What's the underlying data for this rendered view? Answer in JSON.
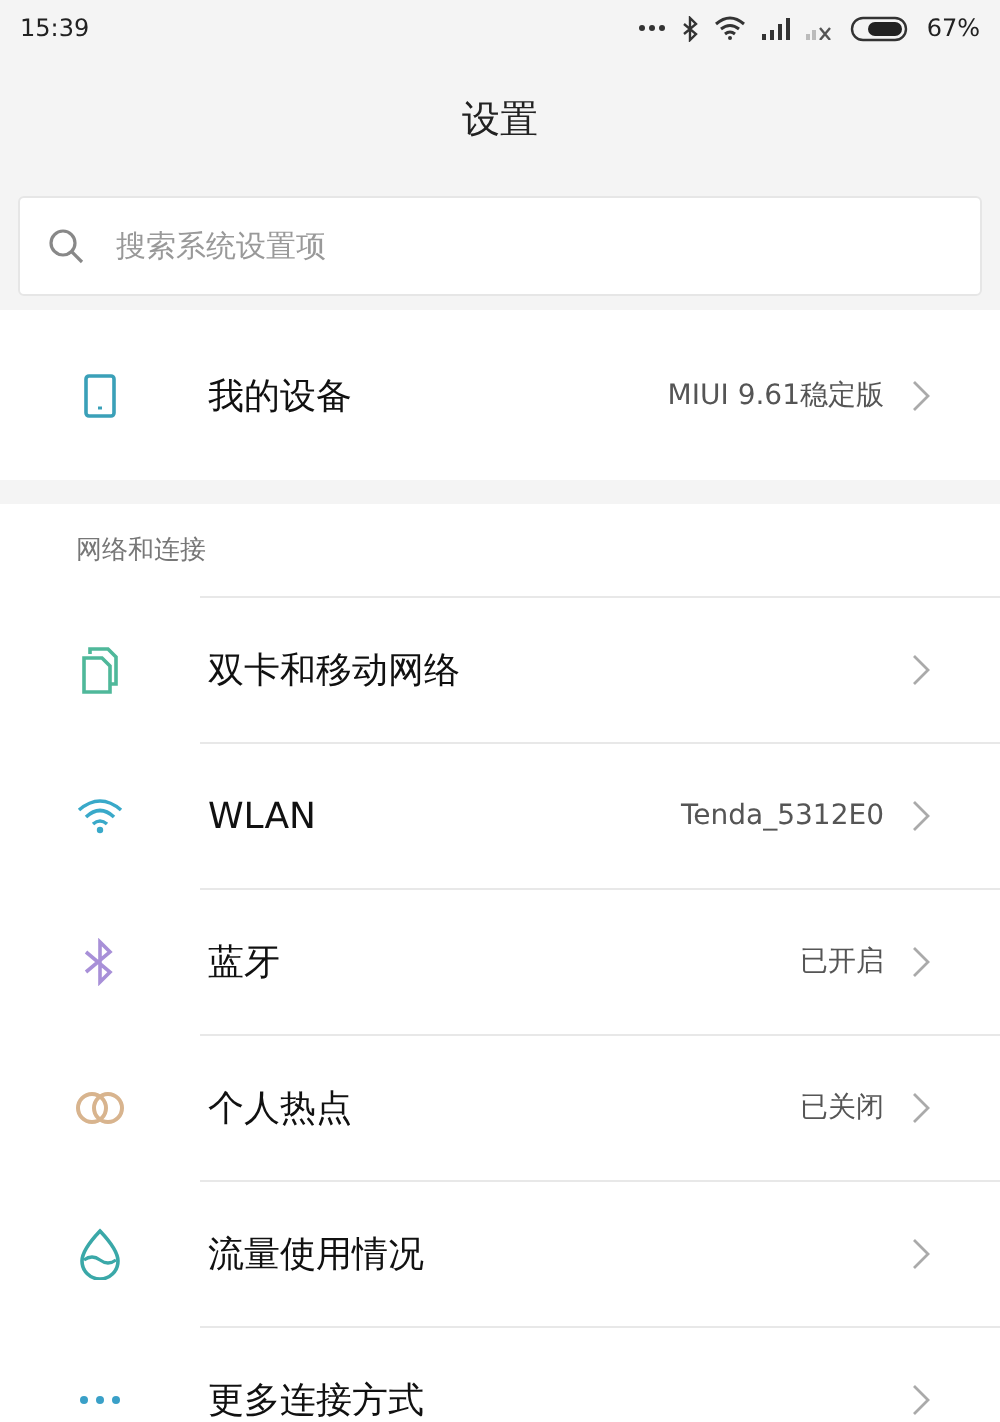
{
  "status_bar": {
    "time": "15:39",
    "battery_text": "67%"
  },
  "window": {
    "title": "设置"
  },
  "search": {
    "placeholder": "搜索系统设置项"
  },
  "device": {
    "label": "我的设备",
    "value": "MIUI 9.61稳定版"
  },
  "section": {
    "title": "网络和连接",
    "items": [
      {
        "label": "双卡和移动网络"
      },
      {
        "label": "WLAN",
        "value": "Tenda_5312E0"
      },
      {
        "label": "蓝牙",
        "value": "已开启"
      },
      {
        "label": "个人热点",
        "value": "已关闭"
      },
      {
        "label": "流量使用情况"
      },
      {
        "label": "更多连接方式"
      }
    ]
  }
}
